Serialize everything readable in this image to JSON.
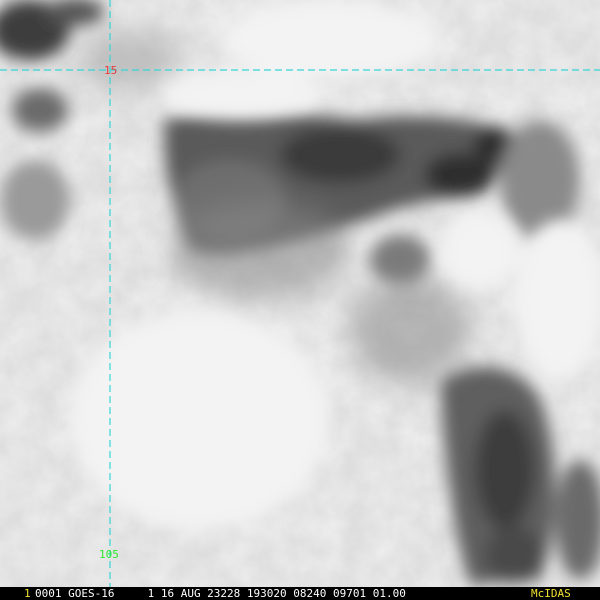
{
  "image": {
    "description_free": true,
    "grid": {
      "line_color": "#36d6d6",
      "latitude_labels": [
        {
          "text": "15",
          "color": "#e83a3a"
        }
      ],
      "longitude_labels": [
        {
          "text": "105",
          "color": "#2ee82e"
        }
      ]
    }
  },
  "statusbar": {
    "frame_number": "1",
    "frame_number_color": "#f0e030",
    "info": "0001 GOES-16     1 16 AUG 23228 193020 08240 09701 01.00",
    "logo": "McIDAS",
    "logo_color": "#f0e030"
  }
}
